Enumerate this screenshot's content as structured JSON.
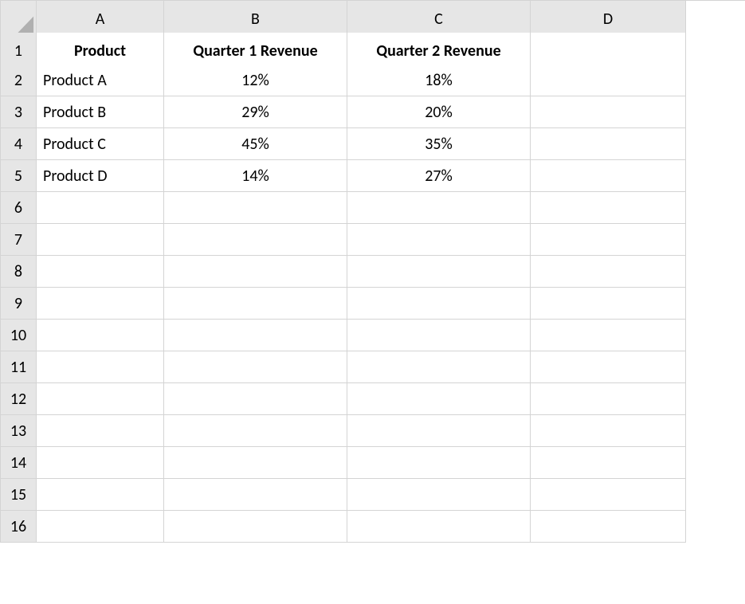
{
  "columns": [
    "A",
    "B",
    "C",
    "D"
  ],
  "rows": [
    "1",
    "2",
    "3",
    "4",
    "5",
    "6",
    "7",
    "8",
    "9",
    "10",
    "11",
    "12",
    "13",
    "14",
    "15",
    "16"
  ],
  "cells": {
    "A1": "Product",
    "B1": "Quarter 1 Revenue",
    "C1": "Quarter 2 Revenue",
    "A2": "Product A",
    "B2": "12%",
    "C2": "18%",
    "A3": "Product B",
    "B3": "29%",
    "C3": "20%",
    "A4": "Product C",
    "B4": "45%",
    "C4": "35%",
    "A5": "Product D",
    "B5": "14%",
    "C5": "27%"
  },
  "chart_data": {
    "type": "table",
    "title": "",
    "columns": [
      "Quarter 1 Revenue",
      "Quarter 2 Revenue"
    ],
    "categories": [
      "Product A",
      "Product B",
      "Product C",
      "Product D"
    ],
    "series": [
      {
        "name": "Quarter 1 Revenue",
        "values": [
          12,
          29,
          45,
          14
        ]
      },
      {
        "name": "Quarter 2 Revenue",
        "values": [
          18,
          20,
          35,
          27
        ]
      }
    ],
    "unit": "percent"
  }
}
